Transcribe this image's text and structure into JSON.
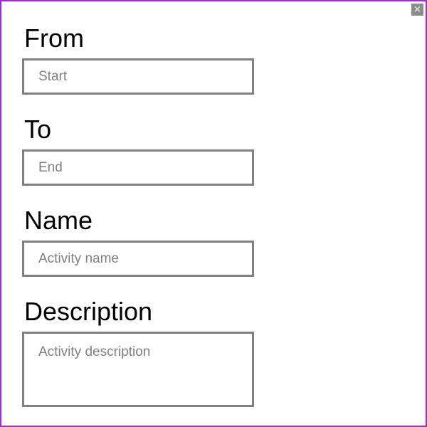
{
  "dialog": {
    "close_label": "×",
    "close_icon": "close-icon"
  },
  "form": {
    "from": {
      "label": "From",
      "placeholder": "Start",
      "value": ""
    },
    "to": {
      "label": "To",
      "placeholder": "End",
      "value": ""
    },
    "name": {
      "label": "Name",
      "placeholder": "Activity name",
      "value": ""
    },
    "description": {
      "label": "Description",
      "placeholder": "Activity description",
      "value": ""
    }
  },
  "colors": {
    "frame_border": "#a32bd6",
    "input_border": "#808080",
    "close_bg": "#8c8c8c",
    "placeholder": "#808080"
  }
}
